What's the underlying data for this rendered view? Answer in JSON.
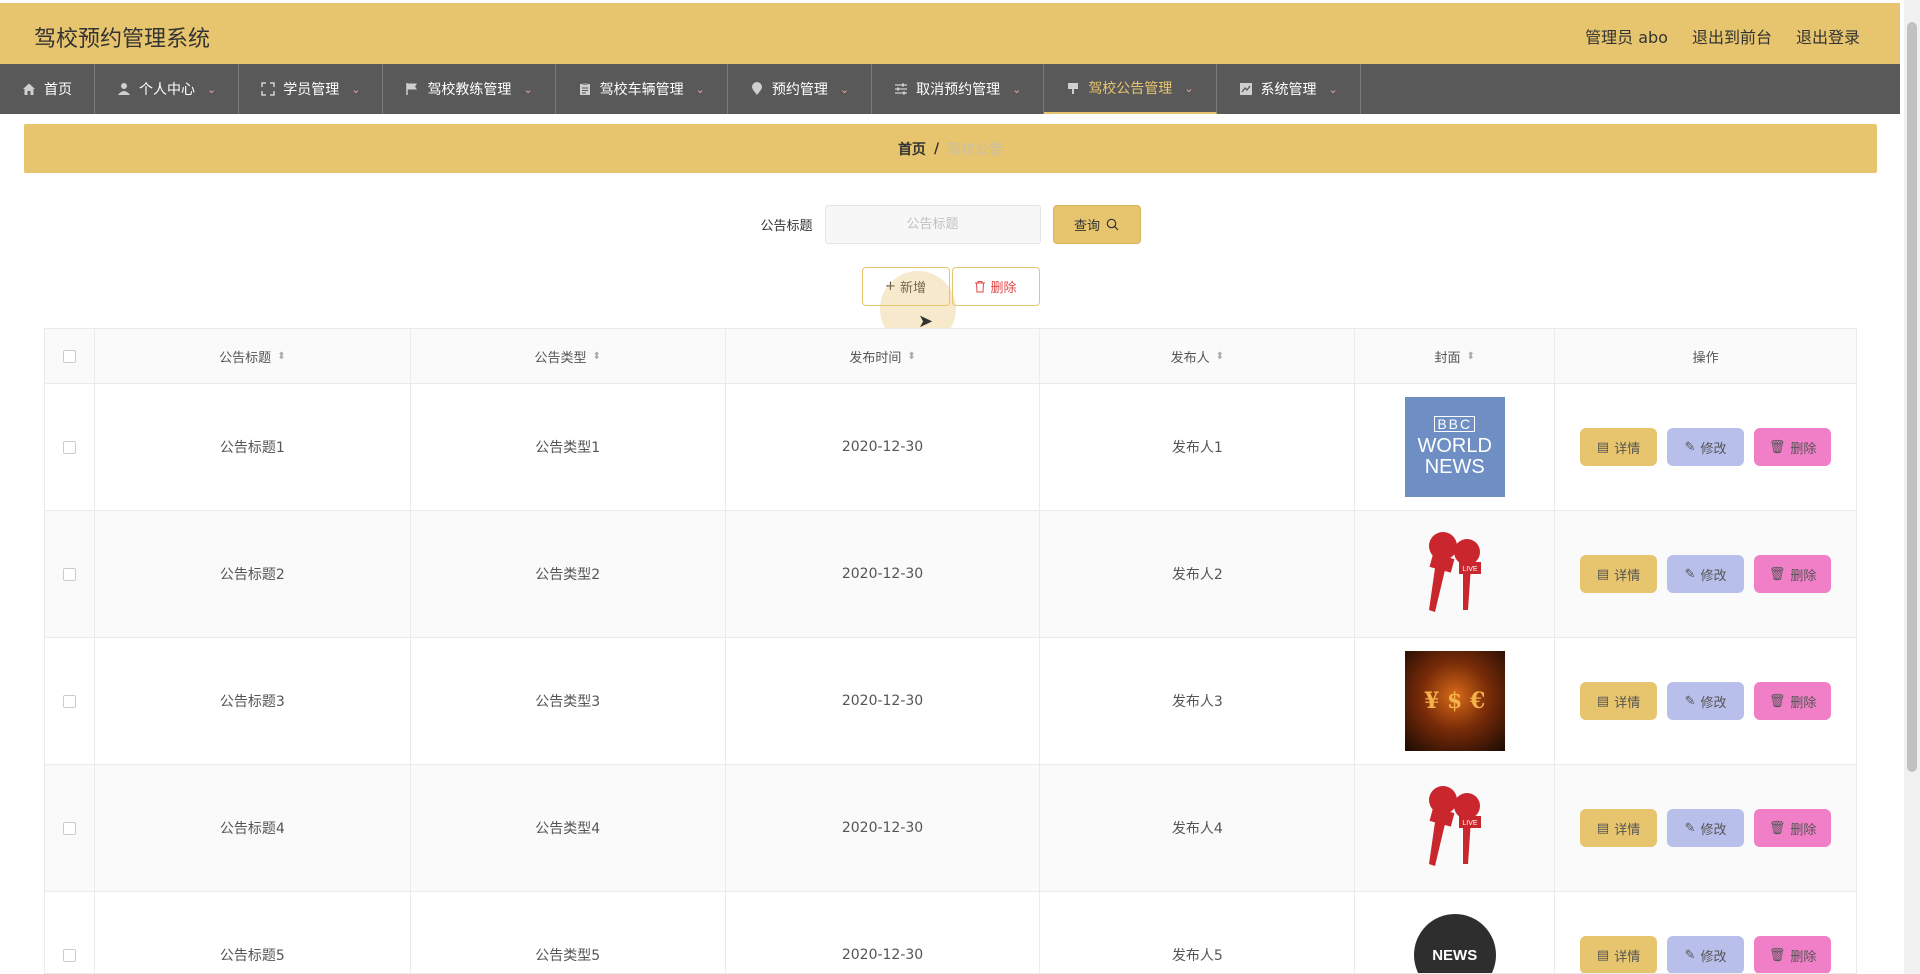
{
  "header": {
    "title": "驾校预约管理系统",
    "user": "管理员 abo",
    "to_front": "退出到前台",
    "logout": "退出登录"
  },
  "nav": [
    {
      "label": "首页",
      "icon": "home-icon",
      "dropdown": false
    },
    {
      "label": "个人中心",
      "icon": "user-icon",
      "dropdown": true
    },
    {
      "label": "学员管理",
      "icon": "fullscreen-icon",
      "dropdown": true
    },
    {
      "label": "驾校教练管理",
      "icon": "flag-icon",
      "dropdown": true
    },
    {
      "label": "驾校车辆管理",
      "icon": "clipboard-icon",
      "dropdown": true
    },
    {
      "label": "预约管理",
      "icon": "location-icon",
      "dropdown": true
    },
    {
      "label": "取消预约管理",
      "icon": "sliders-icon",
      "dropdown": true
    },
    {
      "label": "驾校公告管理",
      "icon": "bell-icon",
      "dropdown": true,
      "active": true
    },
    {
      "label": "系统管理",
      "icon": "chart-icon",
      "dropdown": true
    }
  ],
  "breadcrumb": {
    "home": "首页",
    "separator": "/",
    "current": "驾校公告"
  },
  "search": {
    "label": "公告标题",
    "placeholder": "公告标题",
    "button": "查询"
  },
  "actions": {
    "add": "新增",
    "delete": "删除"
  },
  "table": {
    "columns": [
      "公告标题",
      "公告类型",
      "发布时间",
      "发布人",
      "封面",
      "操作"
    ],
    "rows": [
      {
        "title": "公告标题1",
        "type": "公告类型1",
        "date": "2020-12-30",
        "publisher": "发布人1",
        "cover": "bbc-world-news"
      },
      {
        "title": "公告标题2",
        "type": "公告类型2",
        "date": "2020-12-30",
        "publisher": "发布人2",
        "cover": "live-microphones"
      },
      {
        "title": "公告标题3",
        "type": "公告类型3",
        "date": "2020-12-30",
        "publisher": "发布人3",
        "cover": "currency-symbols"
      },
      {
        "title": "公告标题4",
        "type": "公告类型4",
        "date": "2020-12-30",
        "publisher": "发布人4",
        "cover": "live-microphones"
      },
      {
        "title": "公告标题5",
        "type": "公告类型5",
        "date": "2020-12-30",
        "publisher": "发布人5",
        "cover": "news-globe"
      }
    ],
    "ops": {
      "detail": "详情",
      "edit": "修改",
      "delete": "删除"
    }
  },
  "cover_text": {
    "bbc": "BBC",
    "world_news": "WORLD NEWS",
    "live": "LIVE",
    "news": "NEWS"
  },
  "colors": {
    "accent": "#e7c46e",
    "nav_bg": "#595959",
    "edit_btn": "#b8bfea",
    "delete_btn": "#f07fc8"
  }
}
